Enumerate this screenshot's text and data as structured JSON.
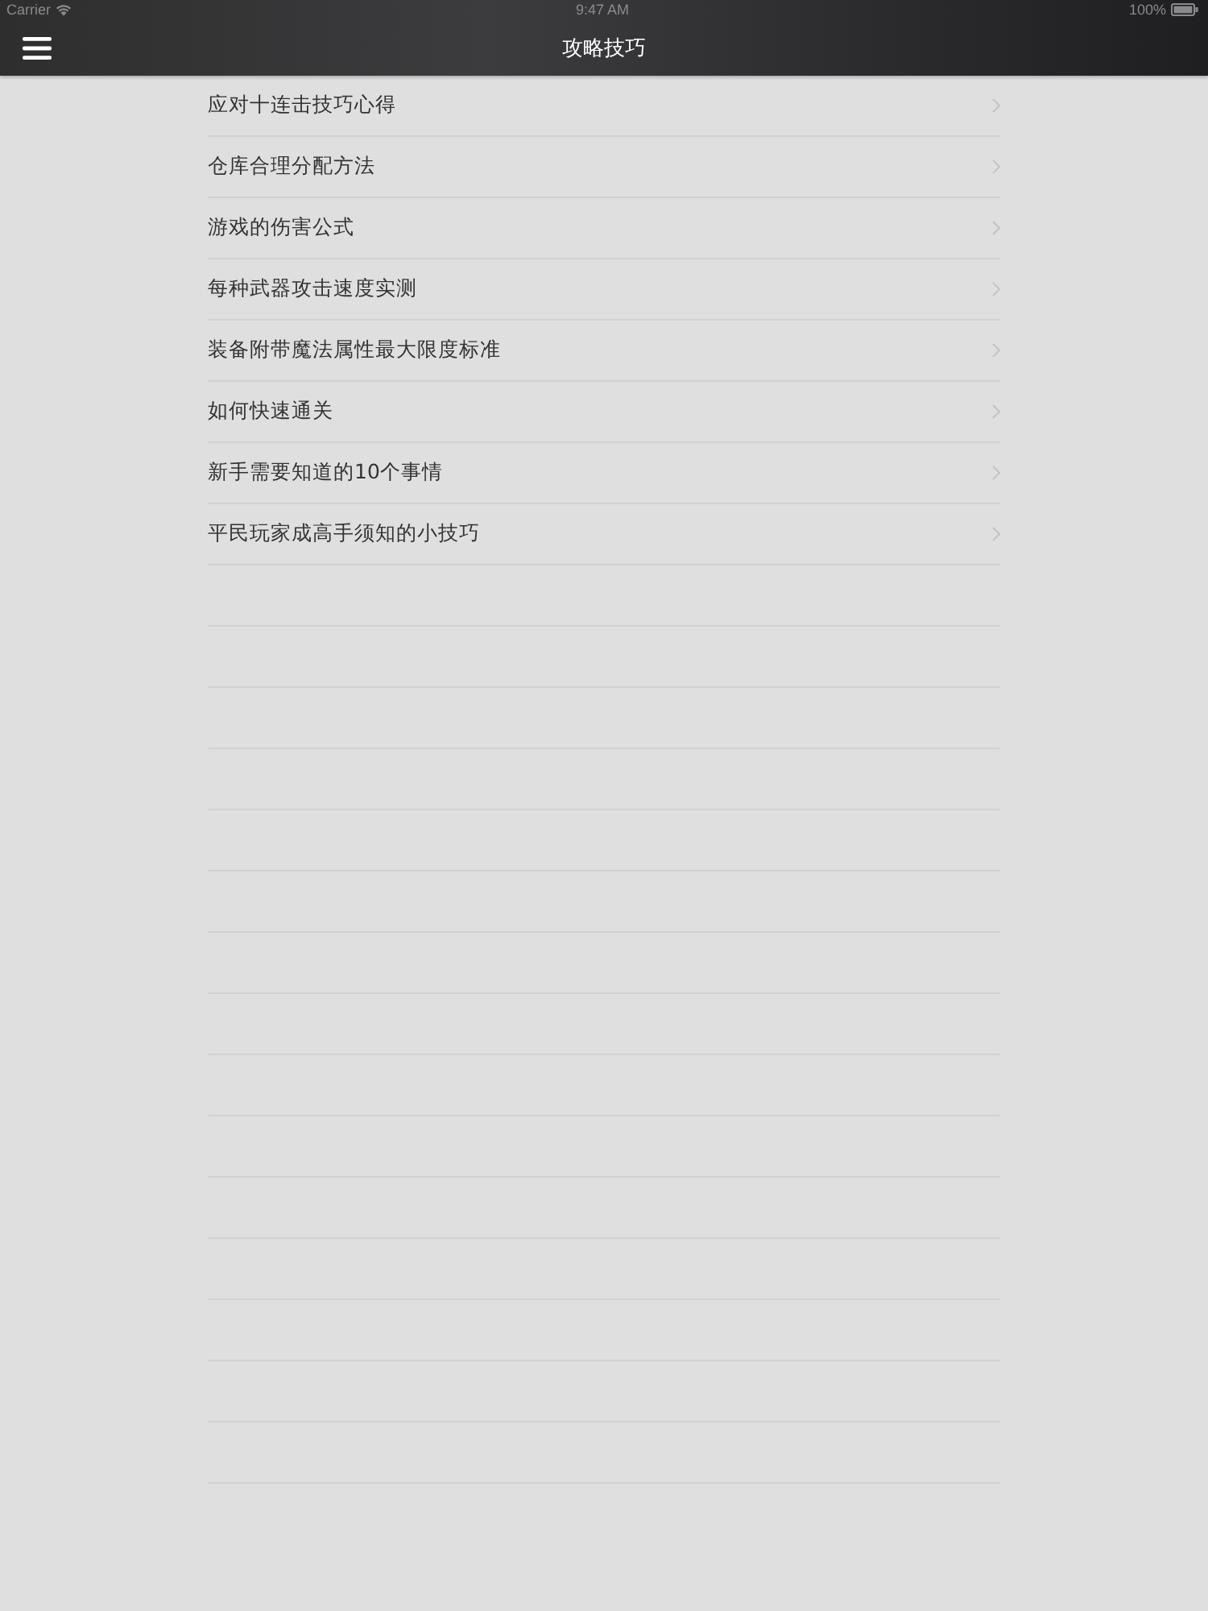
{
  "status_bar": {
    "carrier": "Carrier",
    "time": "9:47 AM",
    "battery": "100%"
  },
  "nav_bar": {
    "title": "攻略技巧"
  },
  "list": {
    "items": [
      {
        "label": "应对十连击技巧心得"
      },
      {
        "label": "仓库合理分配方法"
      },
      {
        "label": "游戏的伤害公式"
      },
      {
        "label": "每种武器攻击速度实测"
      },
      {
        "label": "装备附带魔法属性最大限度标准"
      },
      {
        "label": "如何快速通关"
      },
      {
        "label": "新手需要知道的10个事情"
      },
      {
        "label": "平民玩家成高手须知的小技巧"
      }
    ]
  }
}
